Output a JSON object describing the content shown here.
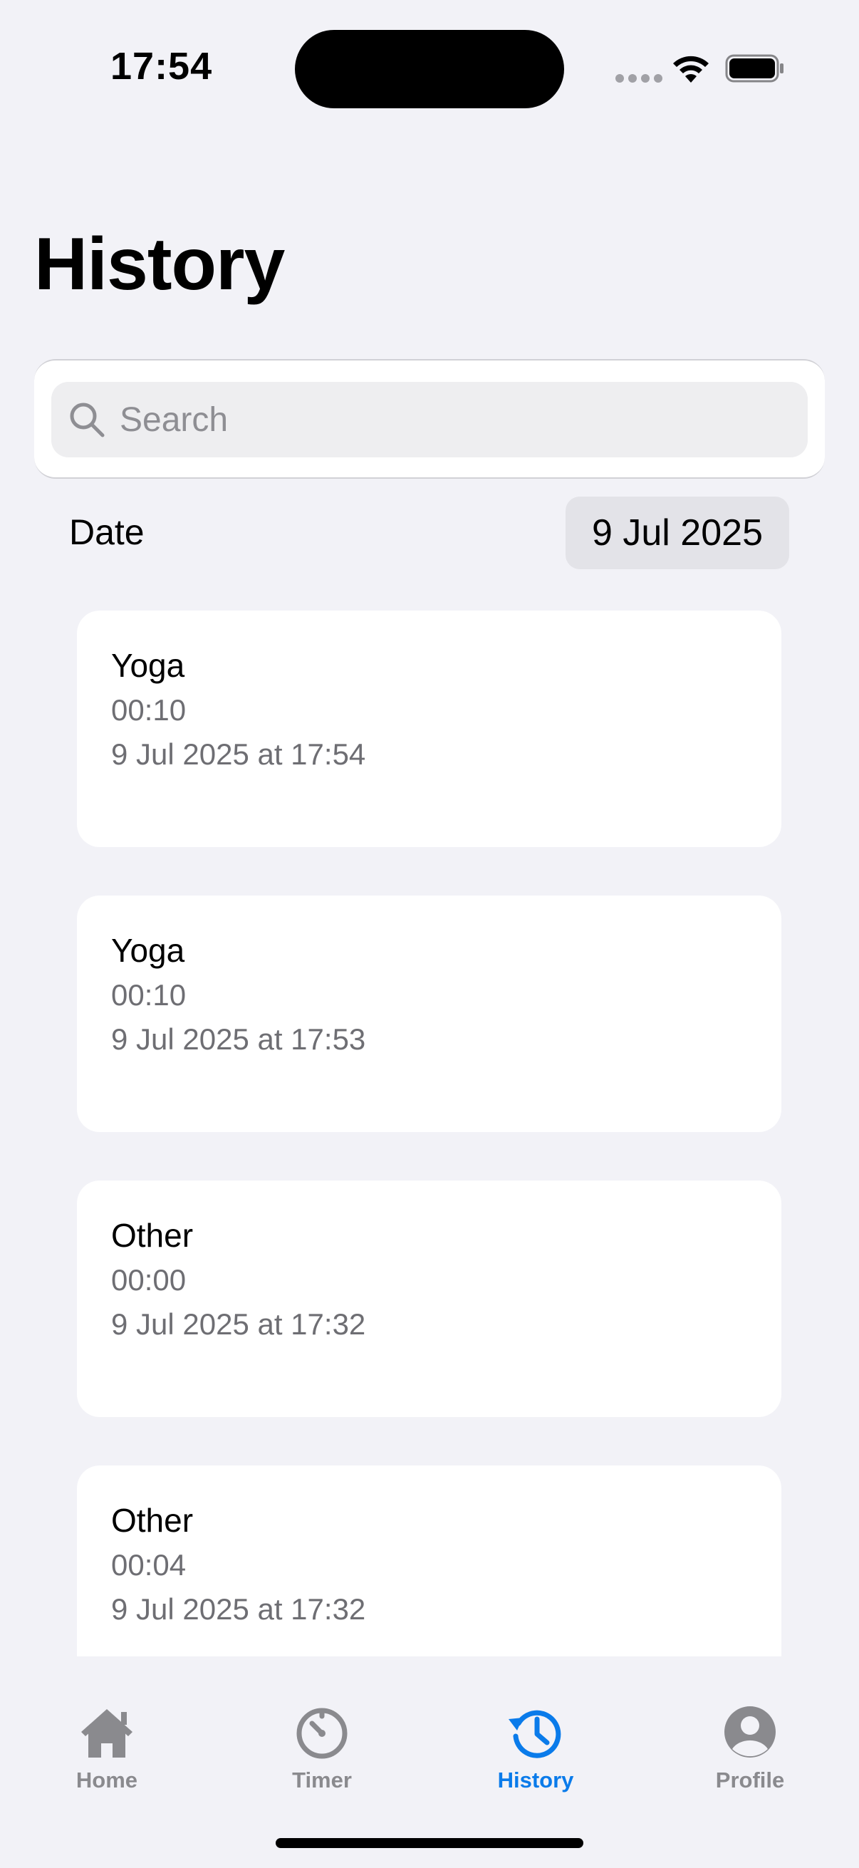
{
  "status_bar": {
    "time": "17:54"
  },
  "header": {
    "title": "History"
  },
  "search": {
    "placeholder": "Search",
    "value": ""
  },
  "date_filter": {
    "label": "Date",
    "value": "9 Jul 2025"
  },
  "sessions": [
    {
      "title": "Yoga",
      "duration": "00:10",
      "datetime": "9 Jul 2025 at 17:54"
    },
    {
      "title": "Yoga",
      "duration": "00:10",
      "datetime": "9 Jul 2025 at 17:53"
    },
    {
      "title": "Other",
      "duration": "00:00",
      "datetime": "9 Jul 2025 at 17:32"
    },
    {
      "title": "Other",
      "duration": "00:04",
      "datetime": "9 Jul 2025 at 17:32"
    }
  ],
  "tab_bar": {
    "items": [
      {
        "label": "Home",
        "icon": "house-icon"
      },
      {
        "label": "Timer",
        "icon": "timer-icon"
      },
      {
        "label": "History",
        "icon": "history-icon",
        "active": true
      },
      {
        "label": "Profile",
        "icon": "person-circle-icon"
      }
    ]
  },
  "colors": {
    "accent": "#0a7bea",
    "background": "#f2f2f7",
    "card": "#ffffff",
    "secondary_text": "#6e6e73",
    "inactive_tab": "#8a8a8e"
  }
}
